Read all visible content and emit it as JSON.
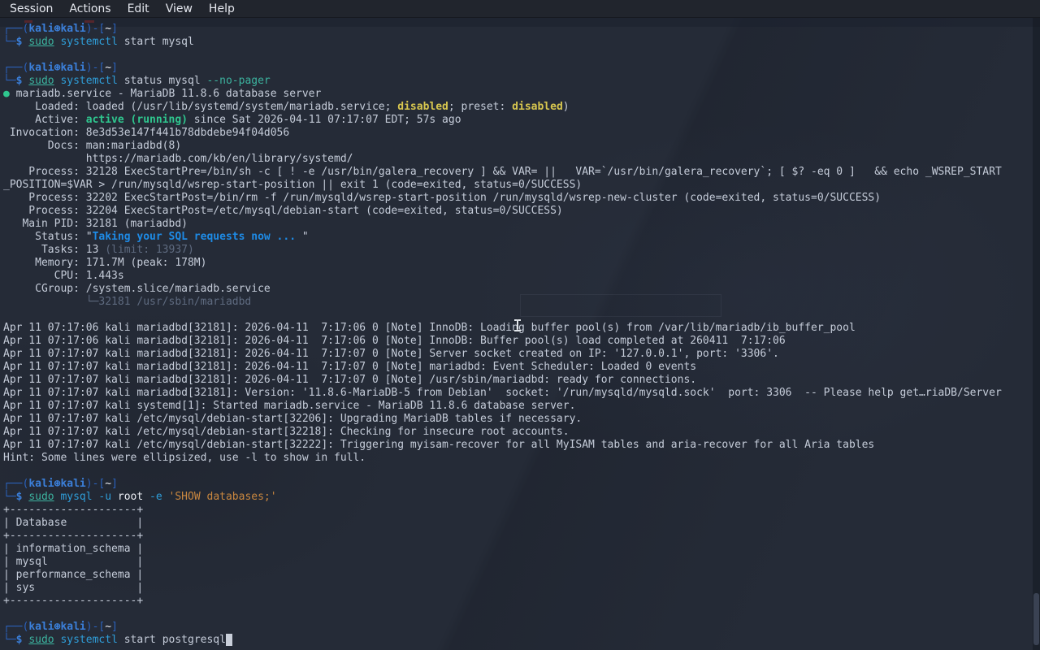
{
  "menubar": {
    "items": [
      "Session",
      "Actions",
      "Edit",
      "View",
      "Help"
    ]
  },
  "palette": {
    "background": "#252b37",
    "menubar_bg": "#21252d",
    "prompt_frame_blue": "#2b62bd",
    "prompt_user_blue": "#3b7fd9",
    "sudo_teal": "#3cb39f",
    "command_cyan": "#2f9ed9",
    "string_orange": "#c9873f",
    "status_yellow": "#d8c74f",
    "status_green": "#2fc78f",
    "status_blue": "#1e8be6",
    "dim_gray": "#5f6b80",
    "text_gray": "#c5ccd9"
  },
  "terminal": {
    "lines": [
      [
        {
          "t": "┌──(",
          "c": "frame"
        },
        {
          "t": "kali⊛kali",
          "c": "user"
        },
        {
          "t": ")-[",
          "c": "frame"
        },
        {
          "t": "~",
          "c": "white"
        },
        {
          "t": "]",
          "c": "frame"
        }
      ],
      [
        {
          "t": "└─",
          "c": "frame"
        },
        {
          "t": "$",
          "c": "user"
        },
        {
          "t": " ",
          "c": "def"
        },
        {
          "t": "sudo",
          "c": "sudo"
        },
        {
          "t": " ",
          "c": "def"
        },
        {
          "t": "systemctl",
          "c": "cmd"
        },
        {
          "t": " start mysql",
          "c": "def"
        }
      ],
      [],
      [
        {
          "t": "┌──(",
          "c": "frame"
        },
        {
          "t": "kali⊛kali",
          "c": "user"
        },
        {
          "t": ")-[",
          "c": "frame"
        },
        {
          "t": "~",
          "c": "white"
        },
        {
          "t": "]",
          "c": "frame"
        }
      ],
      [
        {
          "t": "└─",
          "c": "frame"
        },
        {
          "t": "$",
          "c": "user"
        },
        {
          "t": " ",
          "c": "def"
        },
        {
          "t": "sudo",
          "c": "sudo"
        },
        {
          "t": " ",
          "c": "def"
        },
        {
          "t": "systemctl",
          "c": "cmd"
        },
        {
          "t": " status mysql ",
          "c": "def"
        },
        {
          "t": "--no-pager",
          "c": "teal"
        }
      ],
      [
        {
          "t": "●",
          "c": "green"
        },
        {
          "t": " mariadb.service - MariaDB 11.8.6 database server",
          "c": "def"
        }
      ],
      [
        {
          "t": "     Loaded: loaded (/usr/lib/systemd/system/mariadb.service; ",
          "c": "def"
        },
        {
          "t": "disabled",
          "c": "yellow"
        },
        {
          "t": "; preset: ",
          "c": "def"
        },
        {
          "t": "disabled",
          "c": "yellow"
        },
        {
          "t": ")",
          "c": "def"
        }
      ],
      [
        {
          "t": "     Active: ",
          "c": "def"
        },
        {
          "t": "active (running)",
          "c": "green"
        },
        {
          "t": " since Sat 2026-04-11 07:17:07 EDT; 57s ago",
          "c": "def"
        }
      ],
      [
        {
          "t": " Invocation: 8e3d53e147f441b78dbdebe94f04d056",
          "c": "def"
        }
      ],
      [
        {
          "t": "       Docs: man:mariadbd(8)",
          "c": "def"
        }
      ],
      [
        {
          "t": "             https://mariadb.com/kb/en/library/systemd/",
          "c": "def"
        }
      ],
      [
        {
          "t": "    Process: 32128 ExecStartPre=/bin/sh -c [ ! -e /usr/bin/galera_recovery ] && VAR= ||   VAR=`/usr/bin/galera_recovery`; [ $? -eq 0 ]   && echo _WSREP_START",
          "c": "def"
        }
      ],
      [
        {
          "t": "_POSITION=$VAR > /run/mysqld/wsrep-start-position || exit 1 (code=exited, status=0/SUCCESS)",
          "c": "def"
        }
      ],
      [
        {
          "t": "    Process: 32202 ExecStartPost=/bin/rm -f /run/mysqld/wsrep-start-position /run/mysqld/wsrep-new-cluster (code=exited, status=0/SUCCESS)",
          "c": "def"
        }
      ],
      [
        {
          "t": "    Process: 32204 ExecStartPost=/etc/mysql/debian-start (code=exited, status=0/SUCCESS)",
          "c": "def"
        }
      ],
      [
        {
          "t": "   Main PID: 32181 (mariadbd)",
          "c": "def"
        }
      ],
      [
        {
          "t": "     Status: \"",
          "c": "def"
        },
        {
          "t": "Taking your SQL requests now ...",
          "c": "blue"
        },
        {
          "t": " \"",
          "c": "def"
        }
      ],
      [
        {
          "t": "      Tasks: 13 ",
          "c": "def"
        },
        {
          "t": "(limit: 13937)",
          "c": "dim"
        }
      ],
      [
        {
          "t": "     Memory: 171.7M (peak: 178M)",
          "c": "def"
        }
      ],
      [
        {
          "t": "        CPU: 1.443s",
          "c": "def"
        }
      ],
      [
        {
          "t": "     CGroup: /system.slice/mariadb.service",
          "c": "def"
        }
      ],
      [
        {
          "t": "             └─",
          "c": "dim"
        },
        {
          "t": "32181 /usr/sbin/mariadbd",
          "c": "dim"
        }
      ],
      [],
      [
        {
          "t": "Apr 11 07:17:06 kali mariadbd[32181]: 2026-04-11  7:17:06 0 [Note] InnoDB: Loading buffer pool(s) from /var/lib/mariadb/ib_buffer_pool",
          "c": "def"
        }
      ],
      [
        {
          "t": "Apr 11 07:17:06 kali mariadbd[32181]: 2026-04-11  7:17:06 0 [Note] InnoDB: Buffer pool(s) load completed at 260411  7:17:06",
          "c": "def"
        }
      ],
      [
        {
          "t": "Apr 11 07:17:07 kali mariadbd[32181]: 2026-04-11  7:17:07 0 [Note] Server socket created on IP: '127.0.0.1', port: '3306'.",
          "c": "def"
        }
      ],
      [
        {
          "t": "Apr 11 07:17:07 kali mariadbd[32181]: 2026-04-11  7:17:07 0 [Note] mariadbd: Event Scheduler: Loaded 0 events",
          "c": "def"
        }
      ],
      [
        {
          "t": "Apr 11 07:17:07 kali mariadbd[32181]: 2026-04-11  7:17:07 0 [Note] /usr/sbin/mariadbd: ready for connections.",
          "c": "def"
        }
      ],
      [
        {
          "t": "Apr 11 07:17:07 kali mariadbd[32181]: Version: '11.8.6-MariaDB-5 from Debian'  socket: '/run/mysqld/mysqld.sock'  port: 3306  -- Please help get…riaDB/Server",
          "c": "def"
        }
      ],
      [
        {
          "t": "Apr 11 07:17:07 kali systemd[1]: Started mariadb.service - MariaDB 11.8.6 database server.",
          "c": "def"
        }
      ],
      [
        {
          "t": "Apr 11 07:17:07 kali /etc/mysql/debian-start[32206]: Upgrading MariaDB tables if necessary.",
          "c": "def"
        }
      ],
      [
        {
          "t": "Apr 11 07:17:07 kali /etc/mysql/debian-start[32218]: Checking for insecure root accounts.",
          "c": "def"
        }
      ],
      [
        {
          "t": "Apr 11 07:17:07 kali /etc/mysql/debian-start[32222]: Triggering myisam-recover for all MyISAM tables and aria-recover for all Aria tables",
          "c": "def"
        }
      ],
      [
        {
          "t": "Hint: Some lines were ellipsized, use -l to show in full.",
          "c": "def"
        }
      ],
      [],
      [
        {
          "t": "┌──(",
          "c": "frame"
        },
        {
          "t": "kali⊛kali",
          "c": "user"
        },
        {
          "t": ")-[",
          "c": "frame"
        },
        {
          "t": "~",
          "c": "white"
        },
        {
          "t": "]",
          "c": "frame"
        }
      ],
      [
        {
          "t": "└─",
          "c": "frame"
        },
        {
          "t": "$",
          "c": "user"
        },
        {
          "t": " ",
          "c": "def"
        },
        {
          "t": "sudo",
          "c": "sudo"
        },
        {
          "t": " ",
          "c": "def"
        },
        {
          "t": "mysql",
          "c": "cmd"
        },
        {
          "t": " ",
          "c": "def"
        },
        {
          "t": "-u",
          "c": "cmd"
        },
        {
          "t": " ",
          "c": "def"
        },
        {
          "t": "root",
          "c": "white"
        },
        {
          "t": " ",
          "c": "def"
        },
        {
          "t": "-e",
          "c": "cmd"
        },
        {
          "t": " ",
          "c": "def"
        },
        {
          "t": "'SHOW databases;'",
          "c": "str"
        }
      ],
      [
        {
          "t": "+--------------------+",
          "c": "def"
        }
      ],
      [
        {
          "t": "| Database           |",
          "c": "def"
        }
      ],
      [
        {
          "t": "+--------------------+",
          "c": "def"
        }
      ],
      [
        {
          "t": "| information_schema |",
          "c": "def"
        }
      ],
      [
        {
          "t": "| mysql              |",
          "c": "def"
        }
      ],
      [
        {
          "t": "| performance_schema |",
          "c": "def"
        }
      ],
      [
        {
          "t": "| sys                |",
          "c": "def"
        }
      ],
      [
        {
          "t": "+--------------------+",
          "c": "def"
        }
      ],
      [],
      [
        {
          "t": "┌──(",
          "c": "frame"
        },
        {
          "t": "kali⊛kali",
          "c": "user"
        },
        {
          "t": ")-[",
          "c": "frame"
        },
        {
          "t": "~",
          "c": "white"
        },
        {
          "t": "]",
          "c": "frame"
        }
      ],
      [
        {
          "t": "└─",
          "c": "frame"
        },
        {
          "t": "$",
          "c": "user"
        },
        {
          "t": " ",
          "c": "def"
        },
        {
          "t": "sudo",
          "c": "sudo"
        },
        {
          "t": " ",
          "c": "def"
        },
        {
          "t": "systemctl",
          "c": "cmd"
        },
        {
          "t": " start postgresql",
          "c": "def"
        },
        {
          "t": " ",
          "c": "block"
        }
      ]
    ]
  }
}
